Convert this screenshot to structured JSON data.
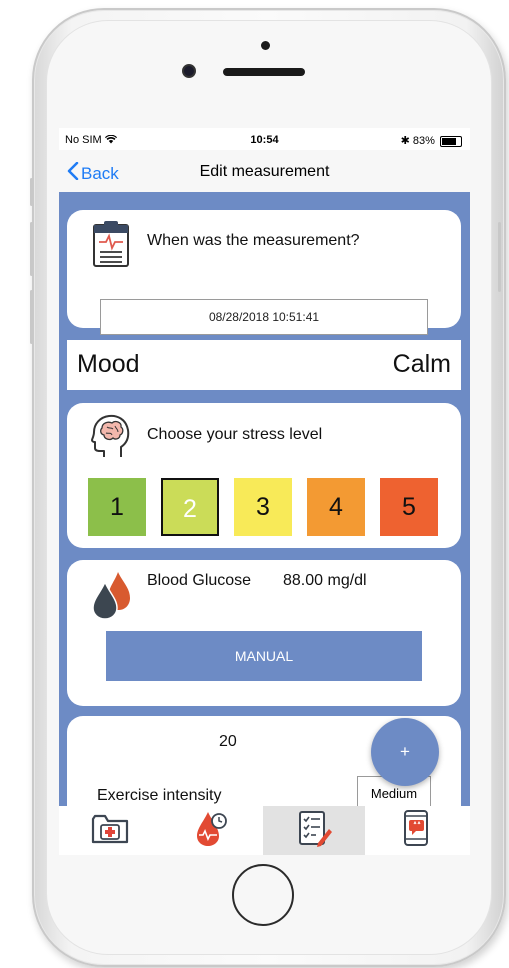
{
  "status": {
    "carrier": "No SIM",
    "time": "10:54",
    "battery": "83%"
  },
  "nav": {
    "back_label": "Back",
    "title": "Edit measurement"
  },
  "measurement": {
    "question": "When was the measurement?",
    "datetime": "08/28/2018 10:51:41"
  },
  "mood": {
    "label": "Mood",
    "value": "Calm"
  },
  "stress": {
    "prompt": "Choose your stress level",
    "selected": 2,
    "levels": [
      {
        "label": "1",
        "color": "#8cbf4a"
      },
      {
        "label": "2",
        "color": "#cbdc58"
      },
      {
        "label": "3",
        "color": "#f8ea58"
      },
      {
        "label": "4",
        "color": "#f39a33"
      },
      {
        "label": "5",
        "color": "#ee6230"
      }
    ]
  },
  "glucose": {
    "label": "Blood Glucose",
    "value": "88.00 mg/dl",
    "button_label": "MANUAL"
  },
  "exercise": {
    "value": "20",
    "intensity_label": "Exercise intensity",
    "intensity_value": "Medium"
  },
  "fab_label": "+",
  "tabs": [
    {
      "name": "medical-folder-icon"
    },
    {
      "name": "blood-drop-clock-icon"
    },
    {
      "name": "checklist-edit-icon"
    },
    {
      "name": "phone-chat-icon"
    }
  ],
  "colors": {
    "accent": "#6d8bc5",
    "link": "#1f7cf5",
    "active_tab": "#e2e2e2"
  }
}
